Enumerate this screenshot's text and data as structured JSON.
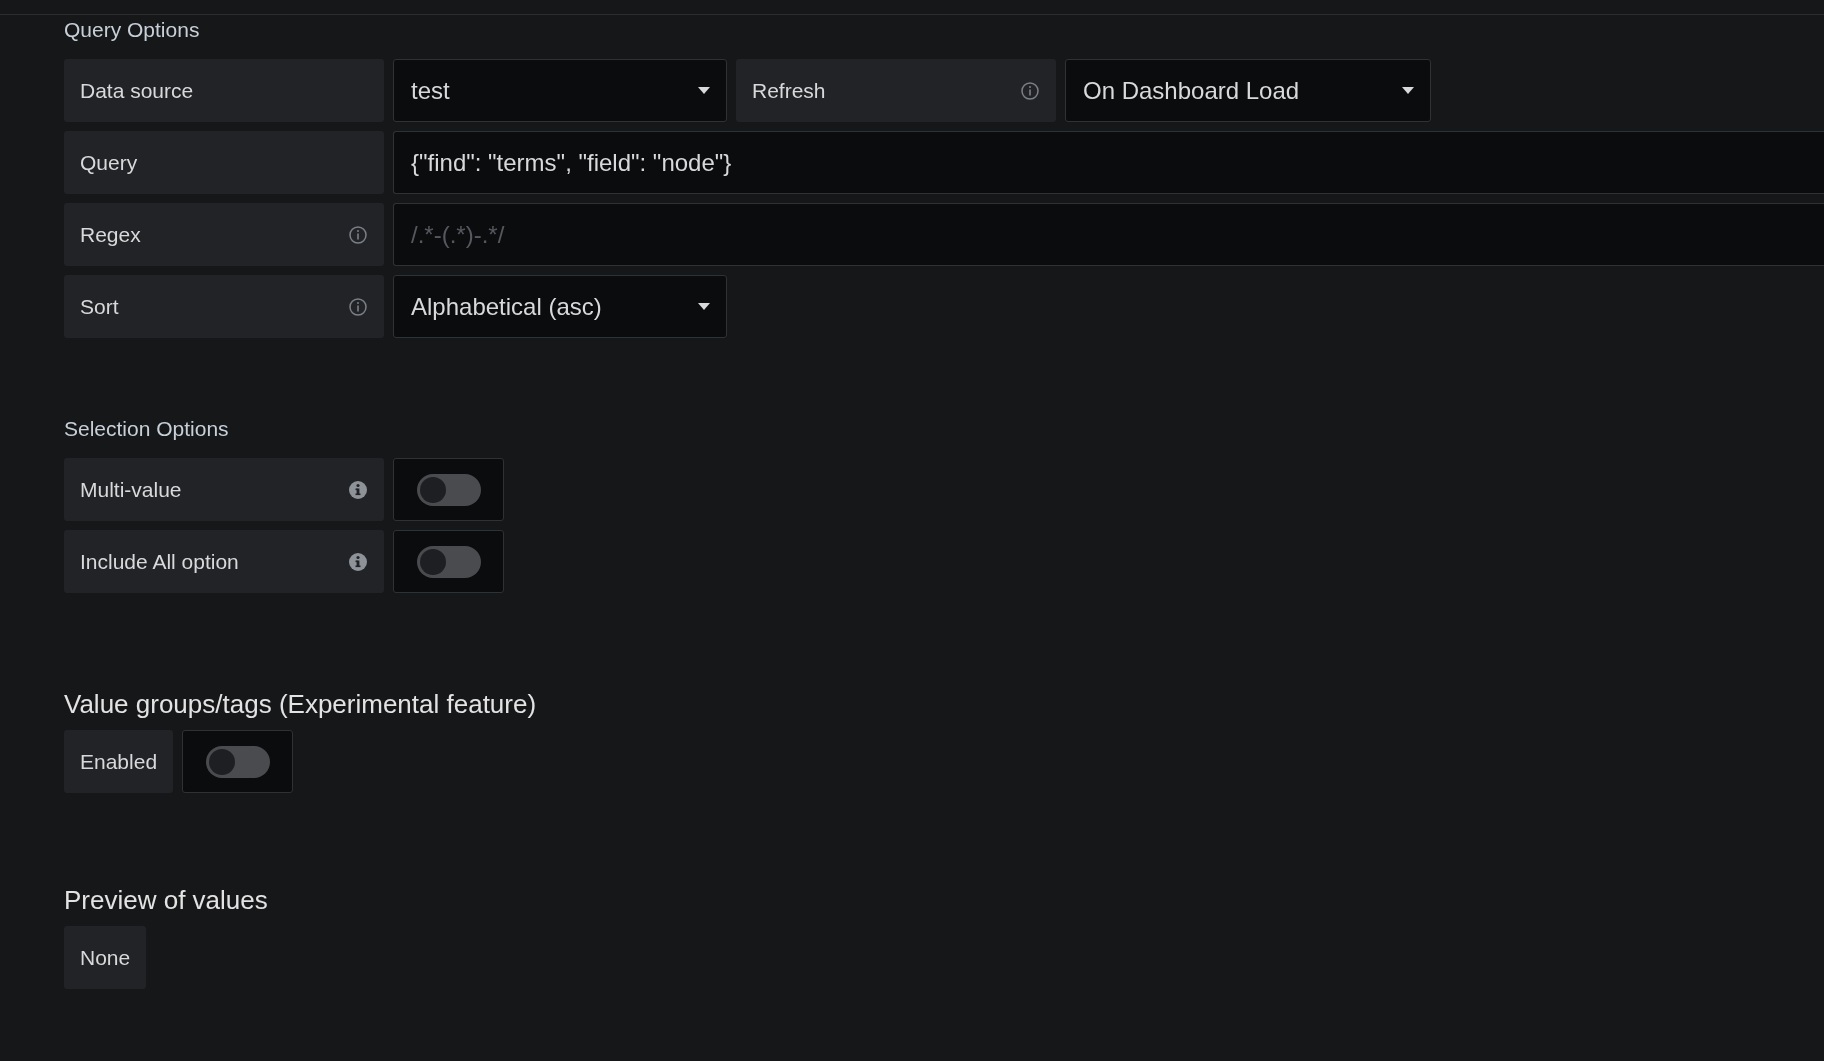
{
  "query_options": {
    "title": "Query Options",
    "rows": [
      [
        {
          "kind": "label",
          "text": "Data source",
          "info": false
        },
        {
          "kind": "select",
          "value": "test"
        },
        {
          "kind": "label",
          "text": "Refresh",
          "info": true
        },
        {
          "kind": "wide_select",
          "value": "On Dashboard Load"
        }
      ],
      [
        {
          "kind": "label",
          "text": "Query",
          "info": false
        },
        {
          "kind": "input",
          "value": "{\"find\": \"terms\", \"field\": \"node\"}"
        }
      ],
      [
        {
          "kind": "label",
          "text": "Regex",
          "info": true
        },
        {
          "kind": "input",
          "placeholder": "/.*-(.*)-.*/"
        }
      ],
      [
        {
          "kind": "label",
          "text": "Sort",
          "info": true
        },
        {
          "kind": "select",
          "value": "Alphabetical (asc)"
        }
      ]
    ]
  },
  "selection_options": {
    "title": "Selection Options",
    "switches": [
      {
        "label": "Multi-value",
        "info": true,
        "checked": false
      },
      {
        "label": "Include All option",
        "info": true,
        "checked": false
      }
    ]
  },
  "value_groups": {
    "title": "Value groups/tags (Experimental feature)",
    "switch": {
      "label": "Enabled",
      "checked": false
    }
  },
  "preview": {
    "title": "Preview of values",
    "values": [
      "None"
    ]
  }
}
